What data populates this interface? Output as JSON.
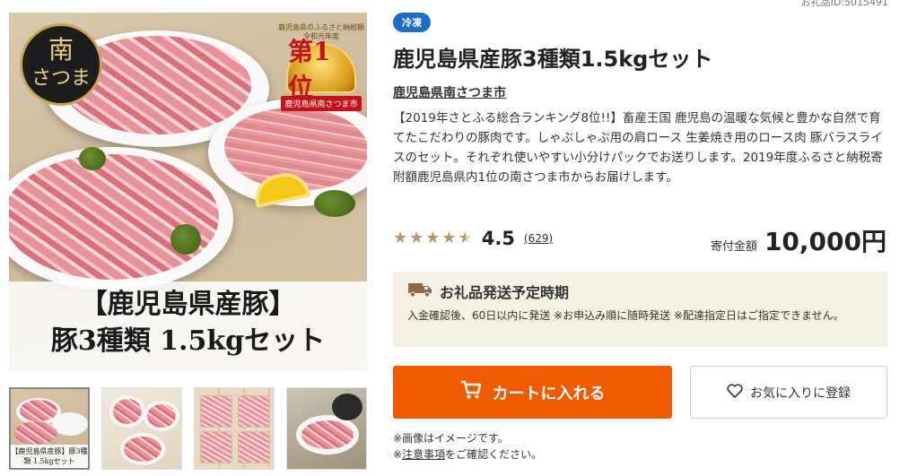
{
  "product": {
    "id_label": "お礼品ID:5015491",
    "tag": "冷凍",
    "title": "鹿児島県産豚3種類1.5kgセット",
    "city": "鹿児島県南さつま市",
    "description": "【2019年さとふる総合ランキング8位!!】畜産王国 鹿児島の温暖な気候と豊かな自然で育てたこだわりの豚肉です。しゃぶしゃぶ用の肩ロース 生姜焼き用のロース肉 豚バラスライスのセット。それぞれ使いやすい小分けパックでお送りします。2019年度ふるさと納税寄附額鹿児島県内1位の南さつま市からお届けします。"
  },
  "rating": {
    "value": "4.5",
    "count": "(629)",
    "stars": 4.5
  },
  "price": {
    "label": "寄付金額",
    "value": "10,000円"
  },
  "shipping": {
    "title": "お礼品発送予定時期",
    "text": "入金確認後、60日以内に発送 ※お申込み順に随時発送 ※配達指定日はご指定できません。",
    "icon": "truck-icon"
  },
  "actions": {
    "cart_label": "カートに入れる",
    "favorite_label": "お気に入りに登録"
  },
  "notes": {
    "image_note": "※画像はイメージです。",
    "caution_prefix": "※",
    "caution_link": "注意事項",
    "caution_suffix": "をご確認ください。"
  },
  "main_image": {
    "logo_line1": "南",
    "logo_line2": "さつま",
    "award_top": "鹿児島県のふるさと納税額",
    "award_year": "令和元年度",
    "award_rank": "第1位",
    "award_ribbon": "鹿児島県南さつま市",
    "caption_line1": "【鹿児島県産豚】",
    "caption_line2": "豚3種類 1.5kgセット"
  },
  "thumbnails": [
    {
      "caption": "【鹿児島県産豚】豚3種類 1.5kgセット"
    },
    {
      "caption": ""
    },
    {
      "caption": ""
    },
    {
      "caption": ""
    }
  ],
  "colors": {
    "cart": "#f25a00",
    "frozen_tag": "#1a6fc4",
    "star": "#b8956a",
    "shipping_bg": "#f5f0e6"
  }
}
